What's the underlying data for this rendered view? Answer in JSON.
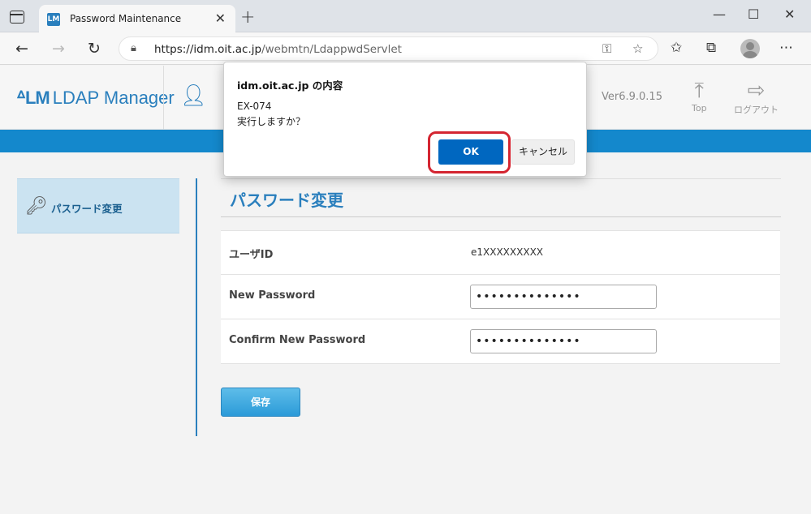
{
  "browser": {
    "tab_title": "Password Maintenance",
    "tab_favicon_text": "LM",
    "tab_close": "✕",
    "new_tab": "+",
    "window_minimize": "—",
    "window_maximize": "☐",
    "window_close": "✕",
    "url_host": "https://idm.oit.ac.jp",
    "url_path": "/webmtn/LdappwdServlet"
  },
  "app": {
    "logo_mark": "ᐞLM",
    "logo_text": "LDAP Manager",
    "version": "Ver6.9.0.15",
    "top_label": "Top",
    "logout_label": "ログアウト"
  },
  "sidebar": {
    "items": [
      {
        "label": "パスワード変更"
      }
    ]
  },
  "main": {
    "section_title": "パスワード変更",
    "rows": [
      {
        "label": "ユーザID",
        "value": "e1XXXXXXXXX"
      },
      {
        "label": "New Password",
        "value": "••••••••••••••"
      },
      {
        "label": "Confirm New Password",
        "value": "••••••••••••••"
      }
    ],
    "save_label": "保存"
  },
  "dialog": {
    "title": "idm.oit.ac.jp の内容",
    "code": "EX-074",
    "message": "実行しますか？",
    "ok_label": "OK",
    "cancel_label": "キャンセル"
  },
  "colors": {
    "accent": "#1488cc",
    "ok_button": "#0067c0",
    "highlight_ring": "#d42531"
  }
}
